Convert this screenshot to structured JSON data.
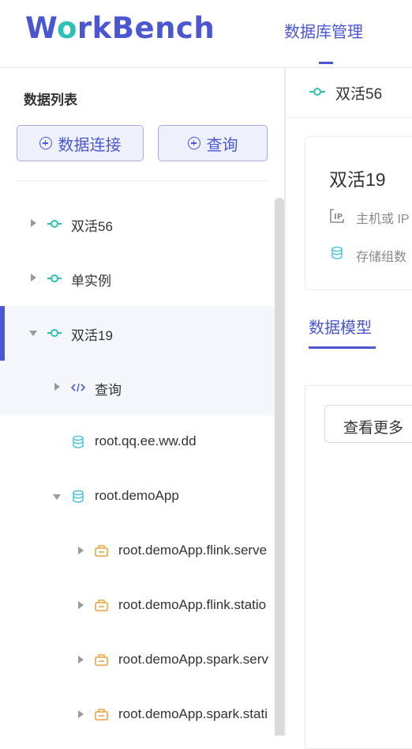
{
  "app": {
    "logo_part1": "W",
    "logo_o": "o",
    "logo_part2": "rkBench",
    "nav_tab": "数据库管理"
  },
  "sidebar": {
    "title": "数据列表",
    "buttons": {
      "connect": "数据连接",
      "query": "查询"
    },
    "tree": [
      {
        "label": "双活56",
        "icon": "connection-icon",
        "expanded": false
      },
      {
        "label": "单实例",
        "icon": "connection-icon",
        "expanded": false
      },
      {
        "label": "双活19",
        "icon": "connection-icon",
        "expanded": true,
        "selected": true
      },
      {
        "label": "查询",
        "icon": "code-icon",
        "expanded": false
      },
      {
        "label": "root.qq.ee.ww.dd",
        "icon": "database-icon"
      },
      {
        "label": "root.demoApp",
        "icon": "database-icon",
        "expanded": true
      },
      {
        "label": "root.demoApp.flink.serve",
        "icon": "device-icon",
        "expanded": false
      },
      {
        "label": "root.demoApp.flink.statio",
        "icon": "device-icon",
        "expanded": false
      },
      {
        "label": "root.demoApp.spark.serv",
        "icon": "device-icon",
        "expanded": false
      },
      {
        "label": "root.demoApp.spark.stati",
        "icon": "device-icon",
        "expanded": false
      }
    ]
  },
  "main": {
    "breadcrumb": "双活56",
    "card": {
      "title": "双活19",
      "host_label": "主机或 IP",
      "storage_label": "存储组数"
    },
    "tab": "数据模型",
    "more_button": "查看更多"
  },
  "colors": {
    "primary": "#4b56d2",
    "teal": "#2cc1b4",
    "db_icon": "#4fc3d9",
    "device_icon": "#e8a23a"
  }
}
